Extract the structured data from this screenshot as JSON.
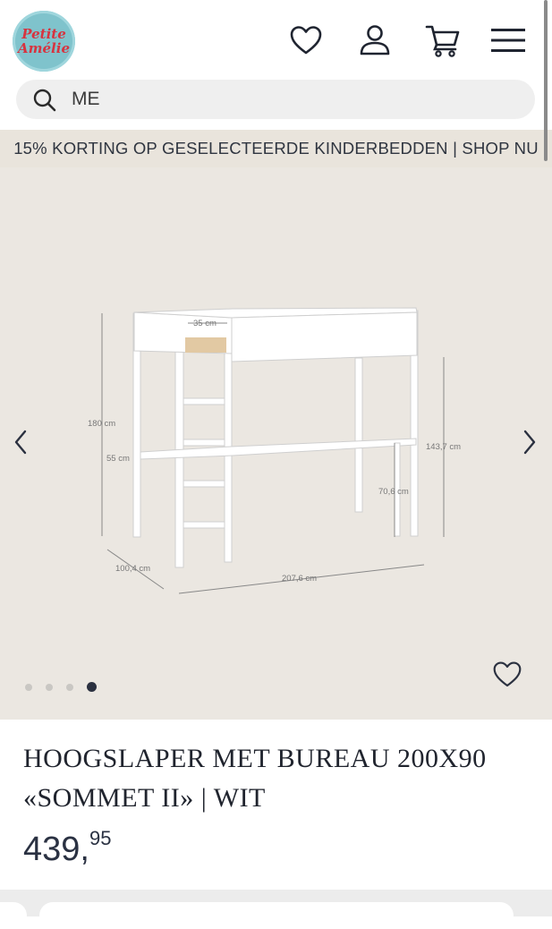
{
  "header": {
    "logo_line1": "Petite",
    "logo_line2": "Amélie",
    "icons": [
      "heart-icon",
      "user-icon",
      "cart-icon",
      "menu-icon"
    ]
  },
  "search": {
    "value": "ME"
  },
  "promo": {
    "text": "15% KORTING OP GESELECTEERDE KINDERBEDDEN | SHOP NU"
  },
  "gallery": {
    "dimensions": {
      "width_top": "35 cm",
      "height_total": "180 cm",
      "desk_depth": "55 cm",
      "height_under": "143,7 cm",
      "desk_height": "70,6 cm",
      "depth": "100,4 cm",
      "length": "207,6 cm"
    },
    "slides": 4,
    "active_slide": 4
  },
  "product": {
    "title_line1": "HOOGSLAPER MET BUREAU 200X90",
    "title_line2": "«SOMMET II» | WIT",
    "price_main": "439,",
    "price_cents": "95"
  },
  "colors": {
    "accent": "#2b3140",
    "promo_bg": "#e9e4dc",
    "gallery_bg": "#ebe7e1",
    "logo_bg": "#7fc3cc",
    "logo_text": "#d7333f"
  }
}
